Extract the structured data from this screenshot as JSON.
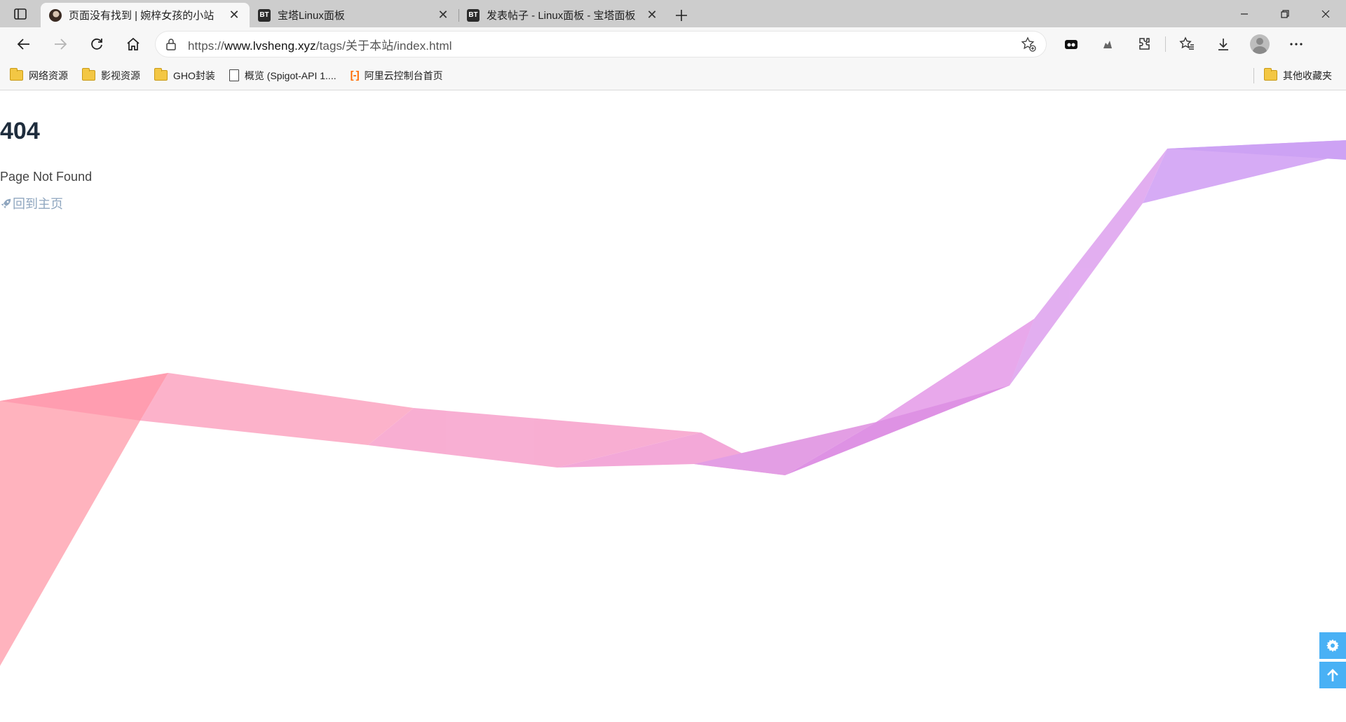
{
  "browser": {
    "tabs": [
      {
        "title": "页面没有找到 | 婉梓女孩的小站",
        "favicon": "avatar-icon",
        "active": true
      },
      {
        "title": "宝塔Linux面板",
        "favicon": "BT",
        "active": false
      },
      {
        "title": "发表帖子 - Linux面板 - 宝塔面板",
        "favicon": "BT",
        "active": false
      }
    ],
    "address": {
      "scheme": "https://",
      "host": "www.lvsheng.xyz",
      "path": "/tags/关于本站/index.html"
    },
    "bookmarks": [
      {
        "label": "网络资源",
        "icon": "folder-icon"
      },
      {
        "label": "影视资源",
        "icon": "folder-icon"
      },
      {
        "label": "GHO封装",
        "icon": "folder-icon"
      },
      {
        "label": "概览 (Spigot-API 1....",
        "icon": "page-icon"
      },
      {
        "label": "阿里云控制台首页",
        "icon": "aliyun-icon"
      }
    ],
    "other_bookmarks": "其他收藏夹"
  },
  "page": {
    "error_code": "404",
    "error_message": "Page Not Found",
    "home_link": "回到主页",
    "accent_color": "#49b1f5"
  }
}
